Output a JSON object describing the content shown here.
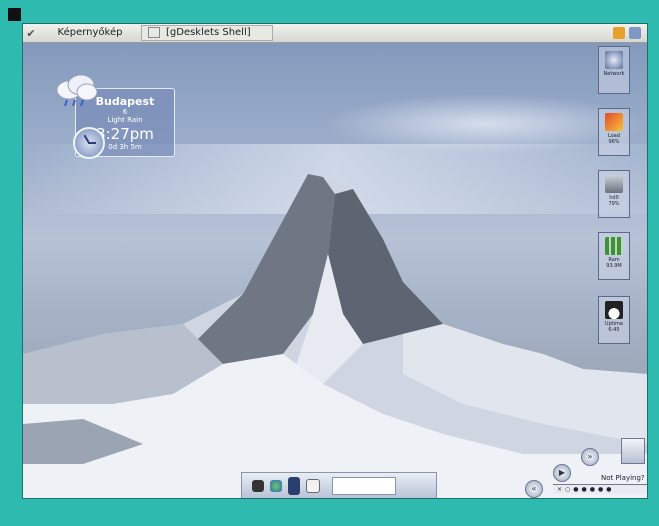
{
  "panel": {
    "task1": "Képernyőkép",
    "task2": "[gDesklets Shell]"
  },
  "weather": {
    "city": "Budapest",
    "temp": "6",
    "condition": "Light Rain",
    "time": "3:27pm",
    "uptime": "0d 3h 5m"
  },
  "sidebar": [
    {
      "label": "Network"
    },
    {
      "label": "Load",
      "value": "96%"
    },
    {
      "label": "hd0",
      "value": "79%"
    },
    {
      "label": "Ram",
      "value": "93.9M"
    },
    {
      "label": "Uptime",
      "value": "6:45"
    }
  ],
  "player": {
    "status": "Not Playing?"
  },
  "colors": {
    "frame": "#2fbab0",
    "weather_panel": "#788cb9",
    "panel_bg": "#e4e4e0"
  },
  "icons": {
    "menu": "bird-icon",
    "weather": "rain-cloud-icon",
    "clock": "clock-icon",
    "network": "network-icon",
    "load": "cpu-load-icon",
    "disk": "disk-icon",
    "ram": "memory-icon",
    "uptime": "penguin-icon"
  }
}
